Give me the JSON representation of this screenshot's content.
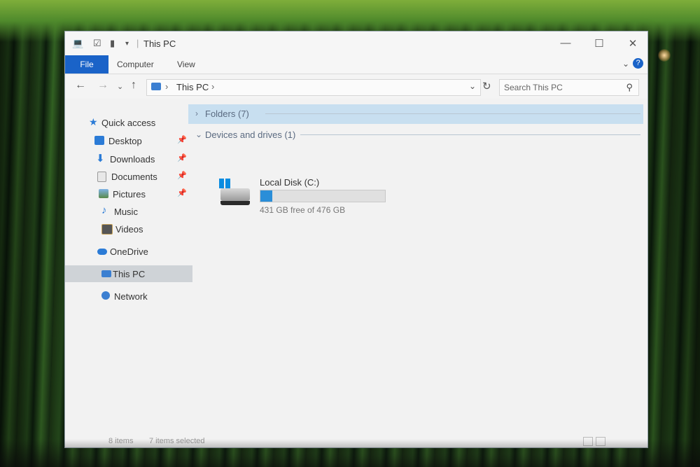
{
  "window": {
    "title": "This PC"
  },
  "ribbon": {
    "tabs": [
      "File",
      "Computer",
      "View"
    ],
    "help": "?"
  },
  "navbar": {
    "breadcrumb": "This PC",
    "search_placeholder": "Search This PC"
  },
  "sidebar": {
    "items": [
      {
        "label": "Quick access",
        "icon": "star-icon"
      },
      {
        "label": "Desktop",
        "icon": "desktop-folder-icon",
        "pinned": true
      },
      {
        "label": "Downloads",
        "icon": "download-arrow-icon",
        "pinned": true
      },
      {
        "label": "Documents",
        "icon": "documents-icon",
        "pinned": true
      },
      {
        "label": "Pictures",
        "icon": "pictures-icon",
        "pinned": true
      },
      {
        "label": "Music",
        "icon": "music-note-icon"
      },
      {
        "label": "Videos",
        "icon": "videos-icon"
      },
      {
        "label": "OneDrive",
        "icon": "cloud-icon"
      },
      {
        "label": "This PC",
        "icon": "computer-icon",
        "selected": true
      },
      {
        "label": "Network",
        "icon": "network-icon"
      }
    ]
  },
  "content": {
    "groups": {
      "folders": "Folders (7)",
      "devices": "Devices and drives (1)"
    },
    "drive": {
      "name": "Local Disk (C:)",
      "free_text": "431 GB free of 476 GB",
      "used_fraction": 0.095
    }
  },
  "status": {
    "items": "8 items",
    "selected": "7 items selected"
  },
  "colors": {
    "accent": "#1a63c8",
    "selection": "#cfd3d7",
    "folder_group": "#c8dff0",
    "drive_fill": "#2a8ed8"
  }
}
